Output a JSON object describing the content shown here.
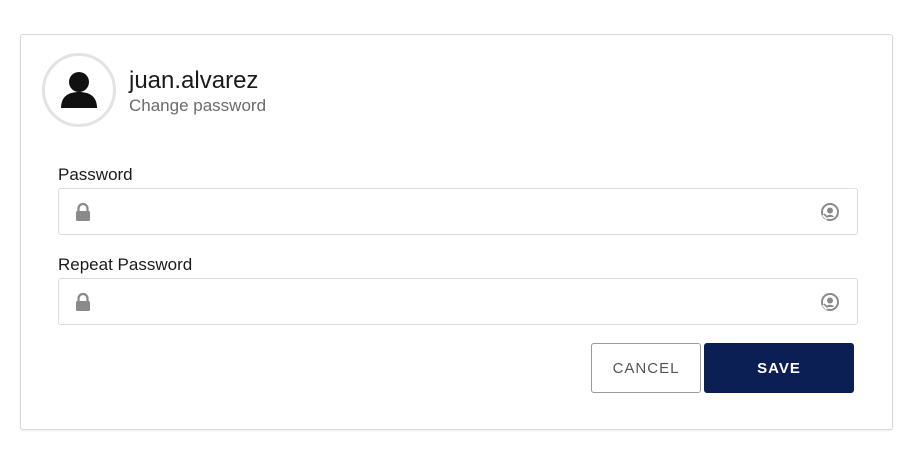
{
  "user": {
    "username": "juan.alvarez",
    "subtitle": "Change password",
    "avatar_icon": "user-icon"
  },
  "form": {
    "password": {
      "label": "Password",
      "value": "",
      "placeholder": "",
      "prefix_icon": "lock-icon",
      "suffix_icon": "eye-toggle-icon"
    },
    "repeat_password": {
      "label": "Repeat Password",
      "value": "",
      "placeholder": "",
      "prefix_icon": "lock-icon",
      "suffix_icon": "eye-toggle-icon"
    }
  },
  "actions": {
    "cancel_label": "CANCEL",
    "save_label": "SAVE"
  },
  "colors": {
    "primary": "#0b1f55",
    "border": "#dcdcdc",
    "muted_text": "#6b6b6b",
    "icon": "#8a8a8a"
  }
}
